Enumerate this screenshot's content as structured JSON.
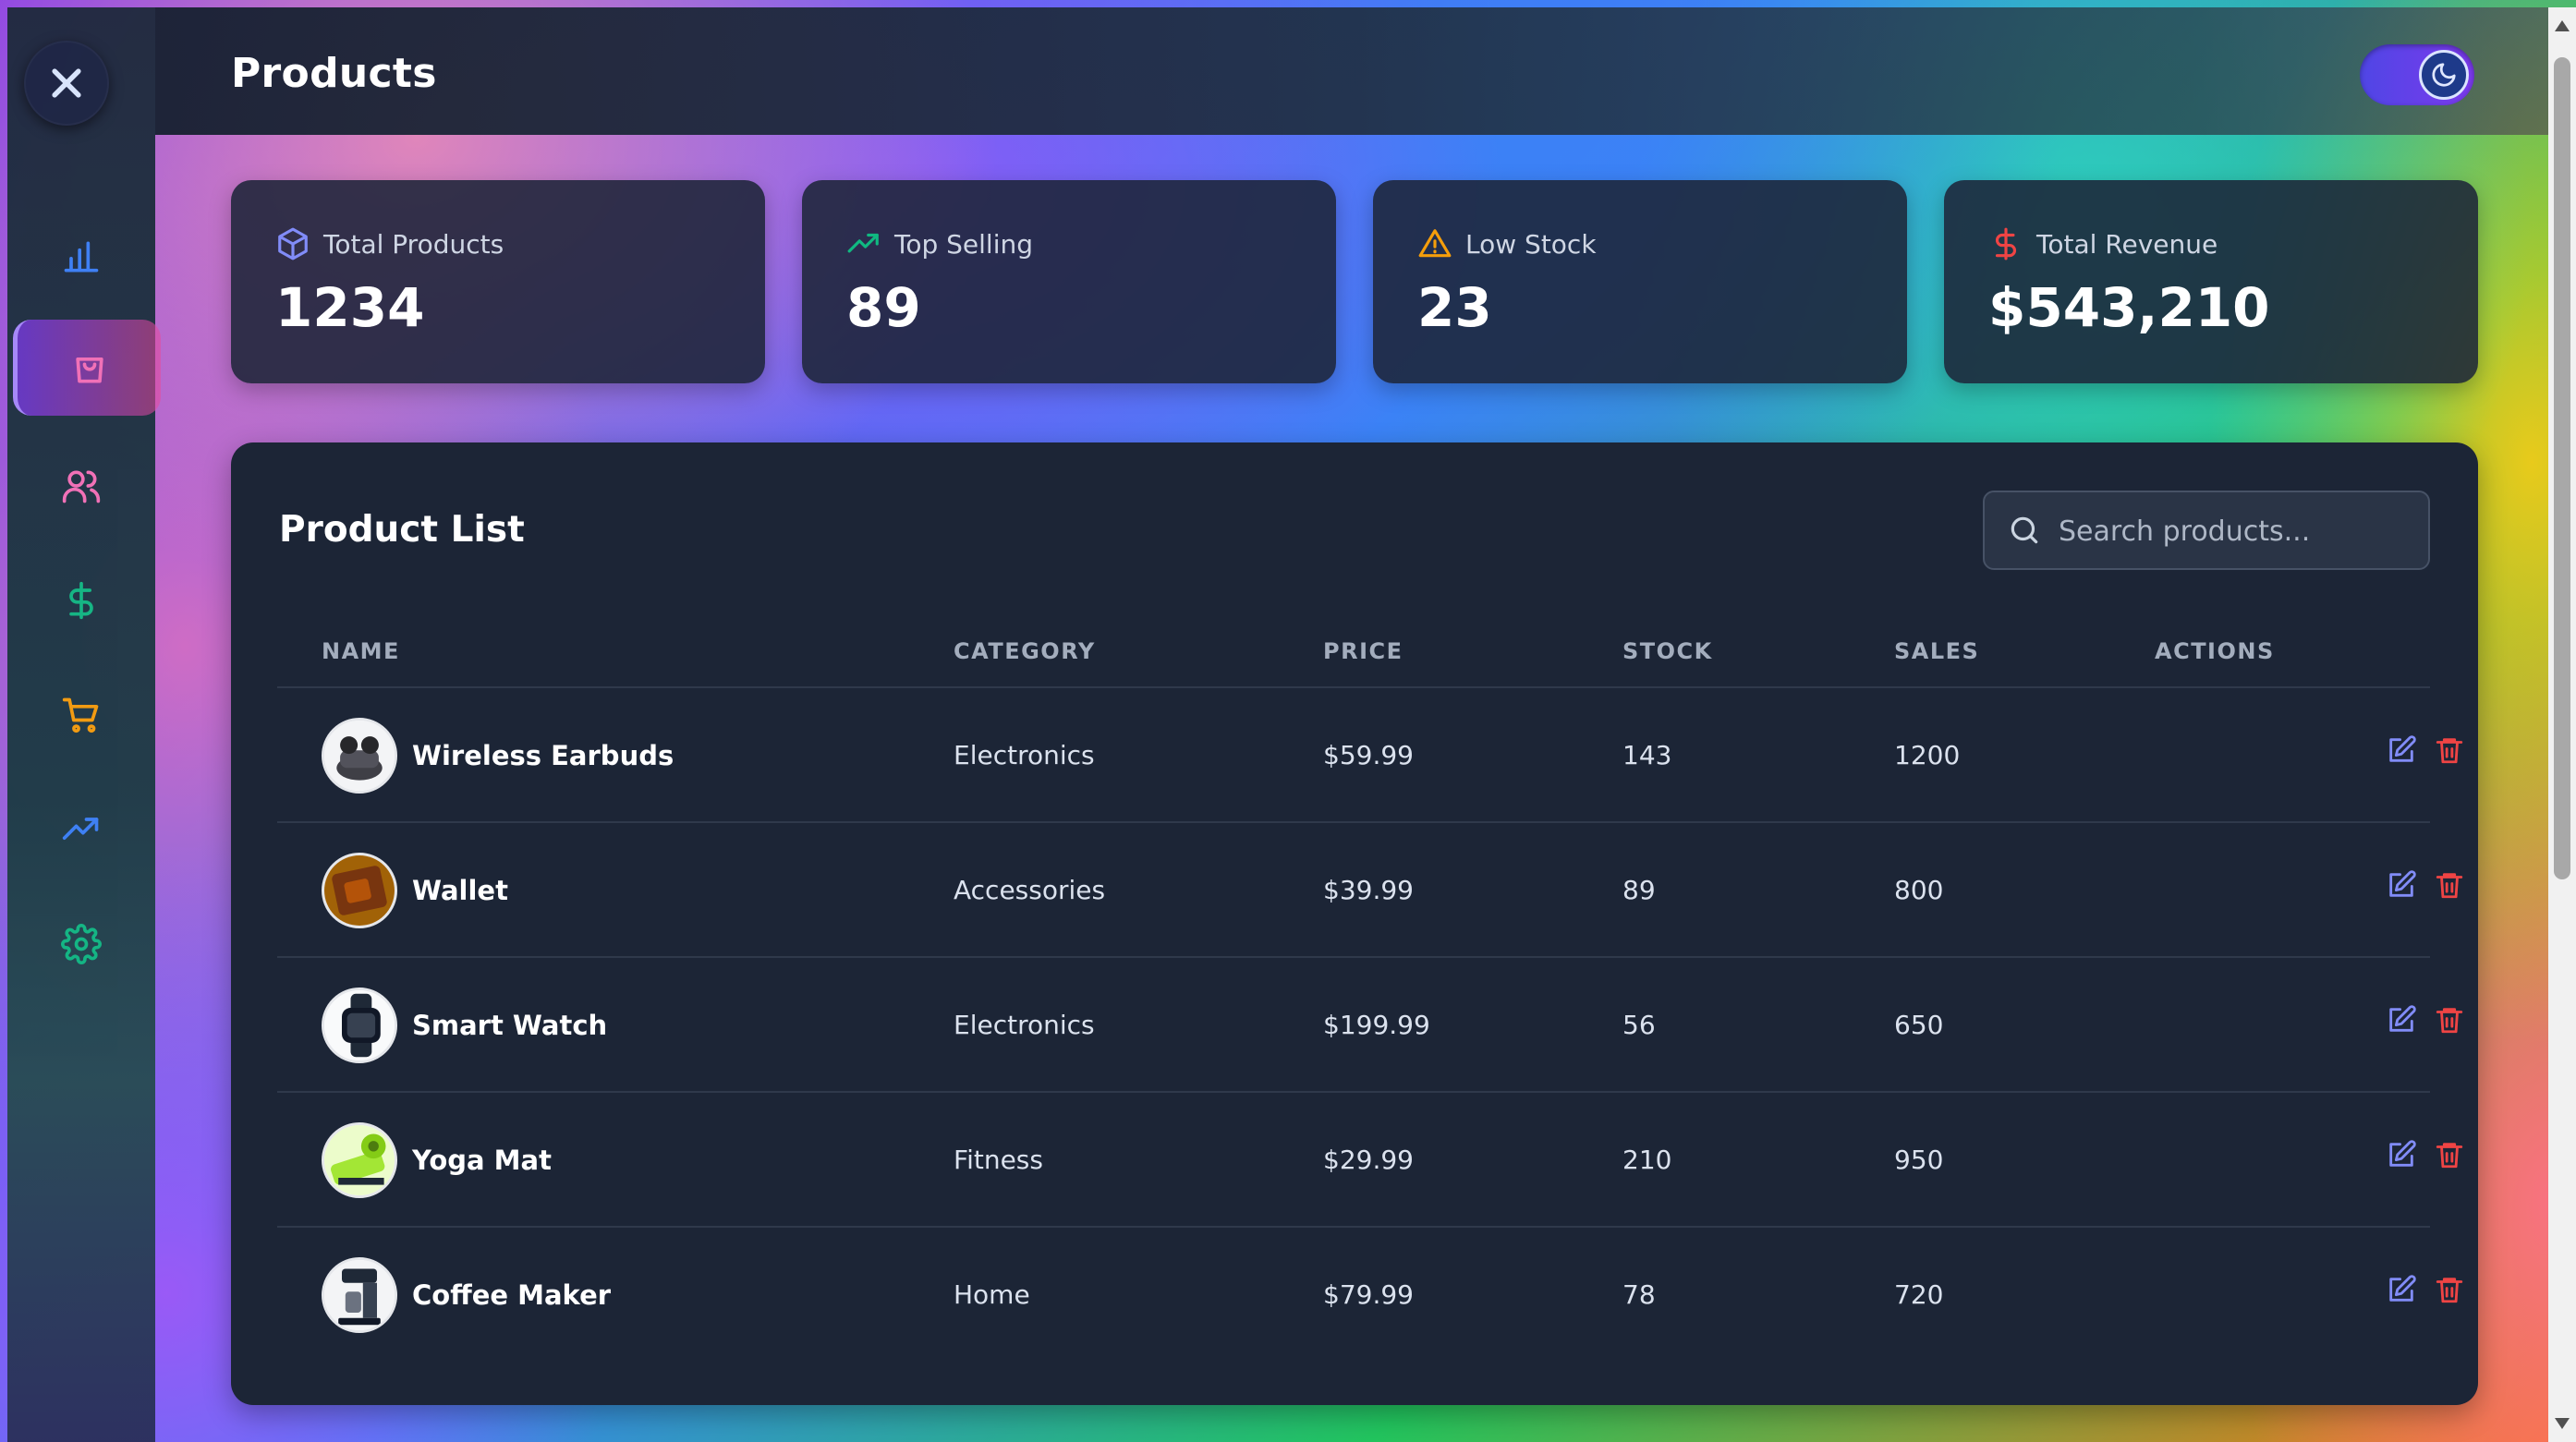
{
  "header": {
    "title": "Products"
  },
  "sidebar": {
    "items": [
      {
        "icon": "bar-chart-icon",
        "color": "#3b82f6"
      },
      {
        "icon": "shopping-bag-icon",
        "color": "#f472b6",
        "active": true
      },
      {
        "icon": "users-icon",
        "color": "#f472b6"
      },
      {
        "icon": "dollar-icon",
        "color": "#10b981"
      },
      {
        "icon": "cart-icon",
        "color": "#f59e0b"
      },
      {
        "icon": "trending-up-icon",
        "color": "#3b82f6"
      },
      {
        "icon": "gear-icon",
        "color": "#10b981"
      }
    ]
  },
  "stats": [
    {
      "label": "Total Products",
      "value": "1234",
      "icon": "package-icon",
      "color": "#818cf8"
    },
    {
      "label": "Top Selling",
      "value": "89",
      "icon": "trending-up-icon",
      "color": "#10b981"
    },
    {
      "label": "Low Stock",
      "value": "23",
      "icon": "warning-icon",
      "color": "#f59e0b"
    },
    {
      "label": "Total Revenue",
      "value": "$543,210",
      "icon": "dollar-icon",
      "color": "#ef4444"
    }
  ],
  "product_list": {
    "title": "Product List",
    "search_placeholder": "Search products...",
    "columns": [
      "NAME",
      "CATEGORY",
      "PRICE",
      "STOCK",
      "SALES",
      "ACTIONS"
    ],
    "rows": [
      {
        "name": "Wireless Earbuds",
        "category": "Electronics",
        "price": "$59.99",
        "stock": "143",
        "sales": "1200"
      },
      {
        "name": "Wallet",
        "category": "Accessories",
        "price": "$39.99",
        "stock": "89",
        "sales": "800"
      },
      {
        "name": "Smart Watch",
        "category": "Electronics",
        "price": "$199.99",
        "stock": "56",
        "sales": "650"
      },
      {
        "name": "Yoga Mat",
        "category": "Fitness",
        "price": "$29.99",
        "stock": "210",
        "sales": "950"
      },
      {
        "name": "Coffee Maker",
        "category": "Home",
        "price": "$79.99",
        "stock": "78",
        "sales": "720"
      }
    ]
  },
  "colors": {
    "accent": "#7c3aed",
    "edit": "#818cf8",
    "delete": "#ef4444"
  }
}
